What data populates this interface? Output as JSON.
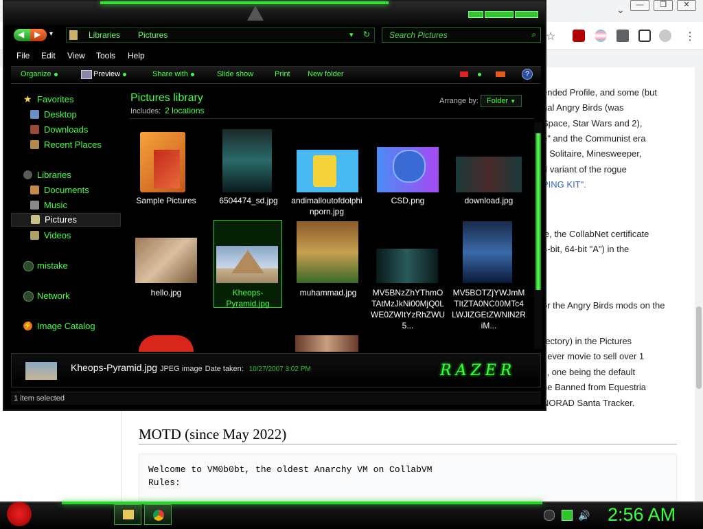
{
  "browser": {
    "window_buttons": [
      "—",
      "❐",
      "✕"
    ],
    "wiki_lines": [
      {
        "text": "ended Profile, and some (but",
        "link": false
      },
      {
        "text": "nal Angry Birds (was",
        "link": false
      },
      {
        "text": "Space, Star Wars and 2),",
        "link": false
      },
      {
        "text": "e\" and the Communist era",
        "link": false
      },
      {
        "text": "s Solitaire, Minesweeper,",
        "link": false
      },
      {
        "text": "d variant of the rogue",
        "link": false
      },
      {
        "text": "PING KIT\".",
        "link": true
      },
      {
        "text": "le, the CollabNet certificate",
        "link": false
      },
      {
        "text": "4-bit, 64-bit \"A\") in the",
        "link": false
      },
      {
        "text": "or the Angry Birds mods on the",
        "link": false
      },
      {
        "text": "rectory) in the Pictures",
        "link": false
      },
      {
        "text": "t ever movie to sell over 1",
        "link": false
      },
      {
        "text": "s, one being the default",
        "link": false
      },
      {
        "text": "he Banned from Equestria",
        "link": false
      },
      {
        "text": "NORAD Santa Tracker.",
        "link": false
      }
    ],
    "motd_heading": "MOTD (since May 2022)",
    "motd_lines": [
      "Welcome to VM0b0bt, the oldest Anarchy VM on CollabVM",
      "Rules:"
    ]
  },
  "explorer": {
    "address": [
      "Libraries",
      "Pictures"
    ],
    "search_placeholder": "Search Pictures",
    "menu": [
      "File",
      "Edit",
      "View",
      "Tools",
      "Help"
    ],
    "commands": [
      "Organize",
      "Preview",
      "Share with",
      "Slide show",
      "Print",
      "New folder"
    ],
    "nav": {
      "favorites": "Favorites",
      "favorites_items": [
        "Desktop",
        "Downloads",
        "Recent Places"
      ],
      "libraries": "Libraries",
      "libraries_items": [
        "Documents",
        "Music",
        "Pictures",
        "Videos"
      ],
      "selected": "Pictures",
      "other": [
        "mistake",
        "Network",
        "Image Catalog"
      ]
    },
    "library": {
      "title": "Pictures library",
      "includes_label": "Includes:",
      "includes_link": "2 locations",
      "arrange_label": "Arrange by:",
      "arrange_value": "Folder"
    },
    "files": [
      {
        "name": "Sample Pictures",
        "kind": "folder"
      },
      {
        "name": "6504474_sd.jpg",
        "kind": "image"
      },
      {
        "name": "andimalloutofdolphinporn.jpg",
        "kind": "image"
      },
      {
        "name": "CSD.png",
        "kind": "image"
      },
      {
        "name": "download.jpg",
        "kind": "image"
      },
      {
        "name": "hello.jpg",
        "kind": "image"
      },
      {
        "name": "Kheops-Pyramid.jpg",
        "kind": "image",
        "selected": true
      },
      {
        "name": "muhammad.jpg",
        "kind": "image"
      },
      {
        "name": "MV5BNzZhYThmOTAtMzJkNi00MjQ0LWE0ZWItYzRhZWU5...",
        "kind": "image"
      },
      {
        "name": "MV5BOTZjYWJmMTItZTA0NC00MTc4LWJlZGEtZWNlN2RiM...",
        "kind": "image"
      }
    ],
    "details": {
      "name": "Kheops-Pyramid.jpg",
      "type": "JPEG image",
      "date_label": "Date taken:",
      "date_value": "10/27/2007 3:02 PM",
      "brand": "RAZER"
    },
    "status": "1 item selected"
  },
  "taskbar": {
    "clock": "2:56 AM"
  }
}
